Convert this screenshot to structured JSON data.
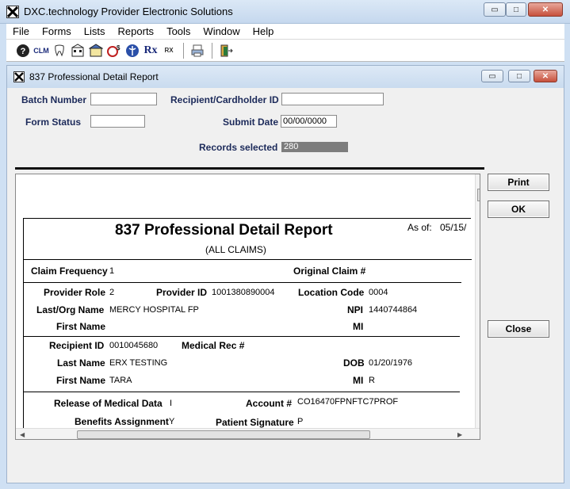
{
  "window": {
    "title": "DXC.technology Provider Electronic Solutions",
    "minimize_glyph": "▭",
    "maximize_glyph": "□",
    "close_glyph": "✕"
  },
  "menu": [
    "File",
    "Forms",
    "Lists",
    "Reports",
    "Tools",
    "Window",
    "Help"
  ],
  "toolbar": {
    "icons": [
      "help-icon",
      "claim-icon",
      "dental-icon",
      "hospital-icon",
      "institutional-icon",
      "calculator-icon",
      "medical-icon",
      "rx-icon",
      "rx-small-icon",
      "print-icon",
      "exit-icon"
    ],
    "clm_text": "CLM",
    "rx_text": "Rx",
    "rx_small_text": "RX"
  },
  "child_window": {
    "title": "837 Professional  Detail Report"
  },
  "form": {
    "batch_number_label": "Batch Number",
    "batch_number_value": "",
    "recipient_label": "Recipient/Cardholder ID",
    "recipient_value": "",
    "form_status_label": "Form Status",
    "form_status_value": "",
    "submit_date_label": "Submit Date",
    "submit_date_value": "00/00/0000",
    "records_selected_label": "Records selected",
    "records_selected_value": "280"
  },
  "buttons": {
    "print": "Print",
    "ok": "OK",
    "close": "Close"
  },
  "report": {
    "title": "837 Professional Detail Report",
    "subtitle": "(ALL CLAIMS)",
    "as_of_label": "As of:",
    "as_of_value": "05/15/",
    "claim_frequency_label": "Claim Frequency",
    "claim_frequency_value": "1",
    "original_claim_label": "Original Claim #",
    "original_claim_value": "",
    "provider_role_label": "Provider Role",
    "provider_role_value": "2",
    "provider_id_label": "Provider ID",
    "provider_id_value": "1001380890004",
    "location_code_label": "Location Code",
    "location_code_value": "0004",
    "last_org_name_label": "Last/Org Name",
    "last_org_name_value": "MERCY HOSPITAL FP",
    "npi_label": "NPI",
    "npi_value": "1440744864",
    "provider_first_name_label": "First Name",
    "provider_first_name_value": "",
    "provider_mi_label": "MI",
    "provider_mi_value": "",
    "recipient_id_label": "Recipient ID",
    "recipient_id_value": "0010045680",
    "medical_rec_label": "Medical Rec #",
    "medical_rec_value": "",
    "last_name_label": "Last Name",
    "last_name_value": "ERX TESTING",
    "dob_label": "DOB",
    "dob_value": "01/20/1976",
    "recipient_first_name_label": "First Name",
    "recipient_first_name_value": "TARA",
    "recipient_mi_label": "MI",
    "recipient_mi_value": "R",
    "release_label": "Release of Medical Data",
    "release_value": "I",
    "account_label": "Account #",
    "account_value": "CO16470FPNFTC7PROF",
    "benefits_label": "Benefits Assignment",
    "benefits_value": "Y",
    "patient_signature_label": "Patient Signature",
    "patient_signature_value": "P"
  }
}
